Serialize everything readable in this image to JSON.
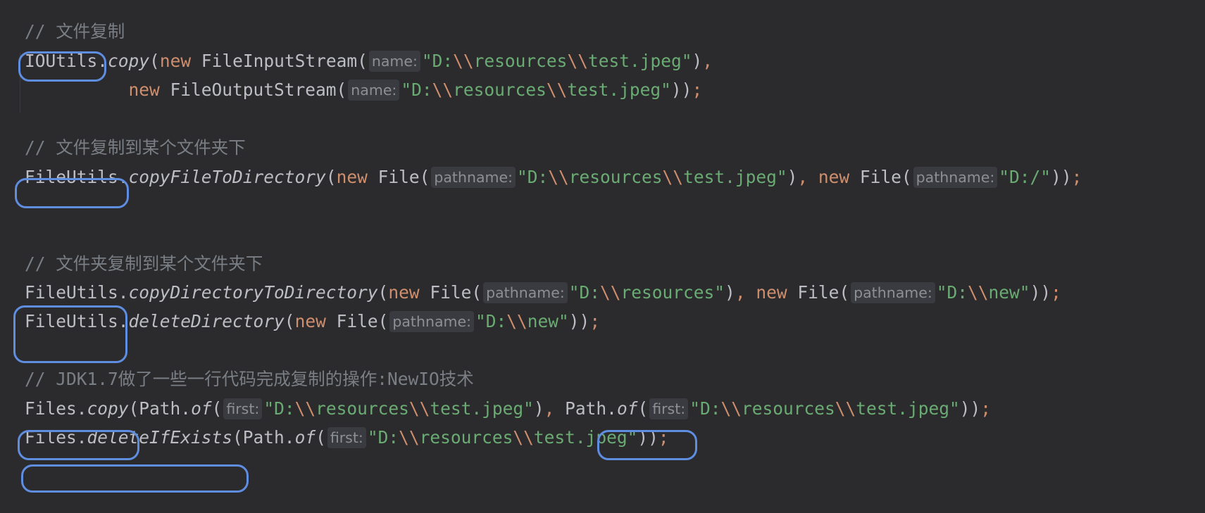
{
  "accent_color": "#5f8de0",
  "code": {
    "c1": "// 文件复制",
    "l1": {
      "cls": "IOUtils",
      "dot": ".",
      "method": "copy",
      "p1": "(",
      "kw": "new",
      "type": " FileInputStream(",
      "hint": "name:",
      "q1": "\"D:",
      "e1": "\\\\",
      "mid": "resources",
      "e2": "\\\\",
      "q2": "test.jpeg\"",
      "close": ")",
      "comma": ","
    },
    "l2": {
      "indent": "          ",
      "kw": "new",
      "type": " FileOutputStream(",
      "hint": "name:",
      "q1": "\"D:",
      "e1": "\\\\",
      "mid": "resources",
      "e2": "\\\\",
      "q2": "test.jpeg\"",
      "close": "))",
      "semi": ";"
    },
    "c2": "// 文件复制到某个文件夹下",
    "l3": {
      "cls": "FileUtils",
      "dot": ".",
      "method": "copyFileToDirectory",
      "p1": "(",
      "kw1": "new",
      "type1": " File(",
      "hint1": "pathname:",
      "q1": "\"D:",
      "e1": "\\\\",
      "mid": "resources",
      "e2": "\\\\",
      "q2": "test.jpeg\"",
      "close1": ")",
      "comma": ", ",
      "kw2": "new",
      "type2": " File(",
      "hint2": "pathname:",
      "q3": "\"D:/\"",
      "close2": "))",
      "semi": ";"
    },
    "c3": "// 文件夹复制到某个文件夹下",
    "l4": {
      "cls": "FileUtils",
      "dot": ".",
      "method": "copyDirectoryToDirectory",
      "p1": "(",
      "kw1": "new",
      "type1": " File(",
      "hint1": "pathname:",
      "q1": "\"D:",
      "e1": "\\\\",
      "q2": "resources\"",
      "close1": ")",
      "comma": ", ",
      "kw2": "new",
      "type2": " File(",
      "hint2": "pathname:",
      "q3": "\"D:",
      "e2": "\\\\",
      "q4": "new\"",
      "close2": "))",
      "semi": ";"
    },
    "l5": {
      "cls": "FileUtils",
      "dot": ".",
      "method": "deleteDirectory",
      "p1": "(",
      "kw": "new",
      "type": " File(",
      "hint": "pathname:",
      "q1": "\"D:",
      "e1": "\\\\",
      "q2": "new\"",
      "close": "))",
      "semi": ";"
    },
    "c4": "// JDK1.7做了一些一行代码完成复制的操作:NewIO技术",
    "l6": {
      "cls": "Files",
      "dot": ".",
      "method": "copy",
      "p1": "(Path.",
      "of1": "of",
      "p2": "(",
      "hint1": "first:",
      "q1": "\"D:",
      "e1": "\\\\",
      "mid1": "resources",
      "e2": "\\\\",
      "q2": "test.jpeg\"",
      "close1": ")",
      "comma": ", ",
      "path2": "Path.",
      "of2": "of",
      "p3": "(",
      "hint2": "first:",
      "q3": "\"D:",
      "e3": "\\\\",
      "mid2": "resources",
      "e4": "\\\\",
      "q4": "test.jpeg\"",
      "close2": "))",
      "semi": ";"
    },
    "l7": {
      "cls": "Files",
      "dot": ".",
      "method": "deleteIfExists",
      "p1": "(Path.",
      "of": "of",
      "p2": "(",
      "hint": "first:",
      "q1": "\"D:",
      "e1": "\\\\",
      "mid": "resources",
      "e2": "\\\\",
      "q2": "test.jpeg\"",
      "close": "))",
      "semi": ";"
    }
  }
}
